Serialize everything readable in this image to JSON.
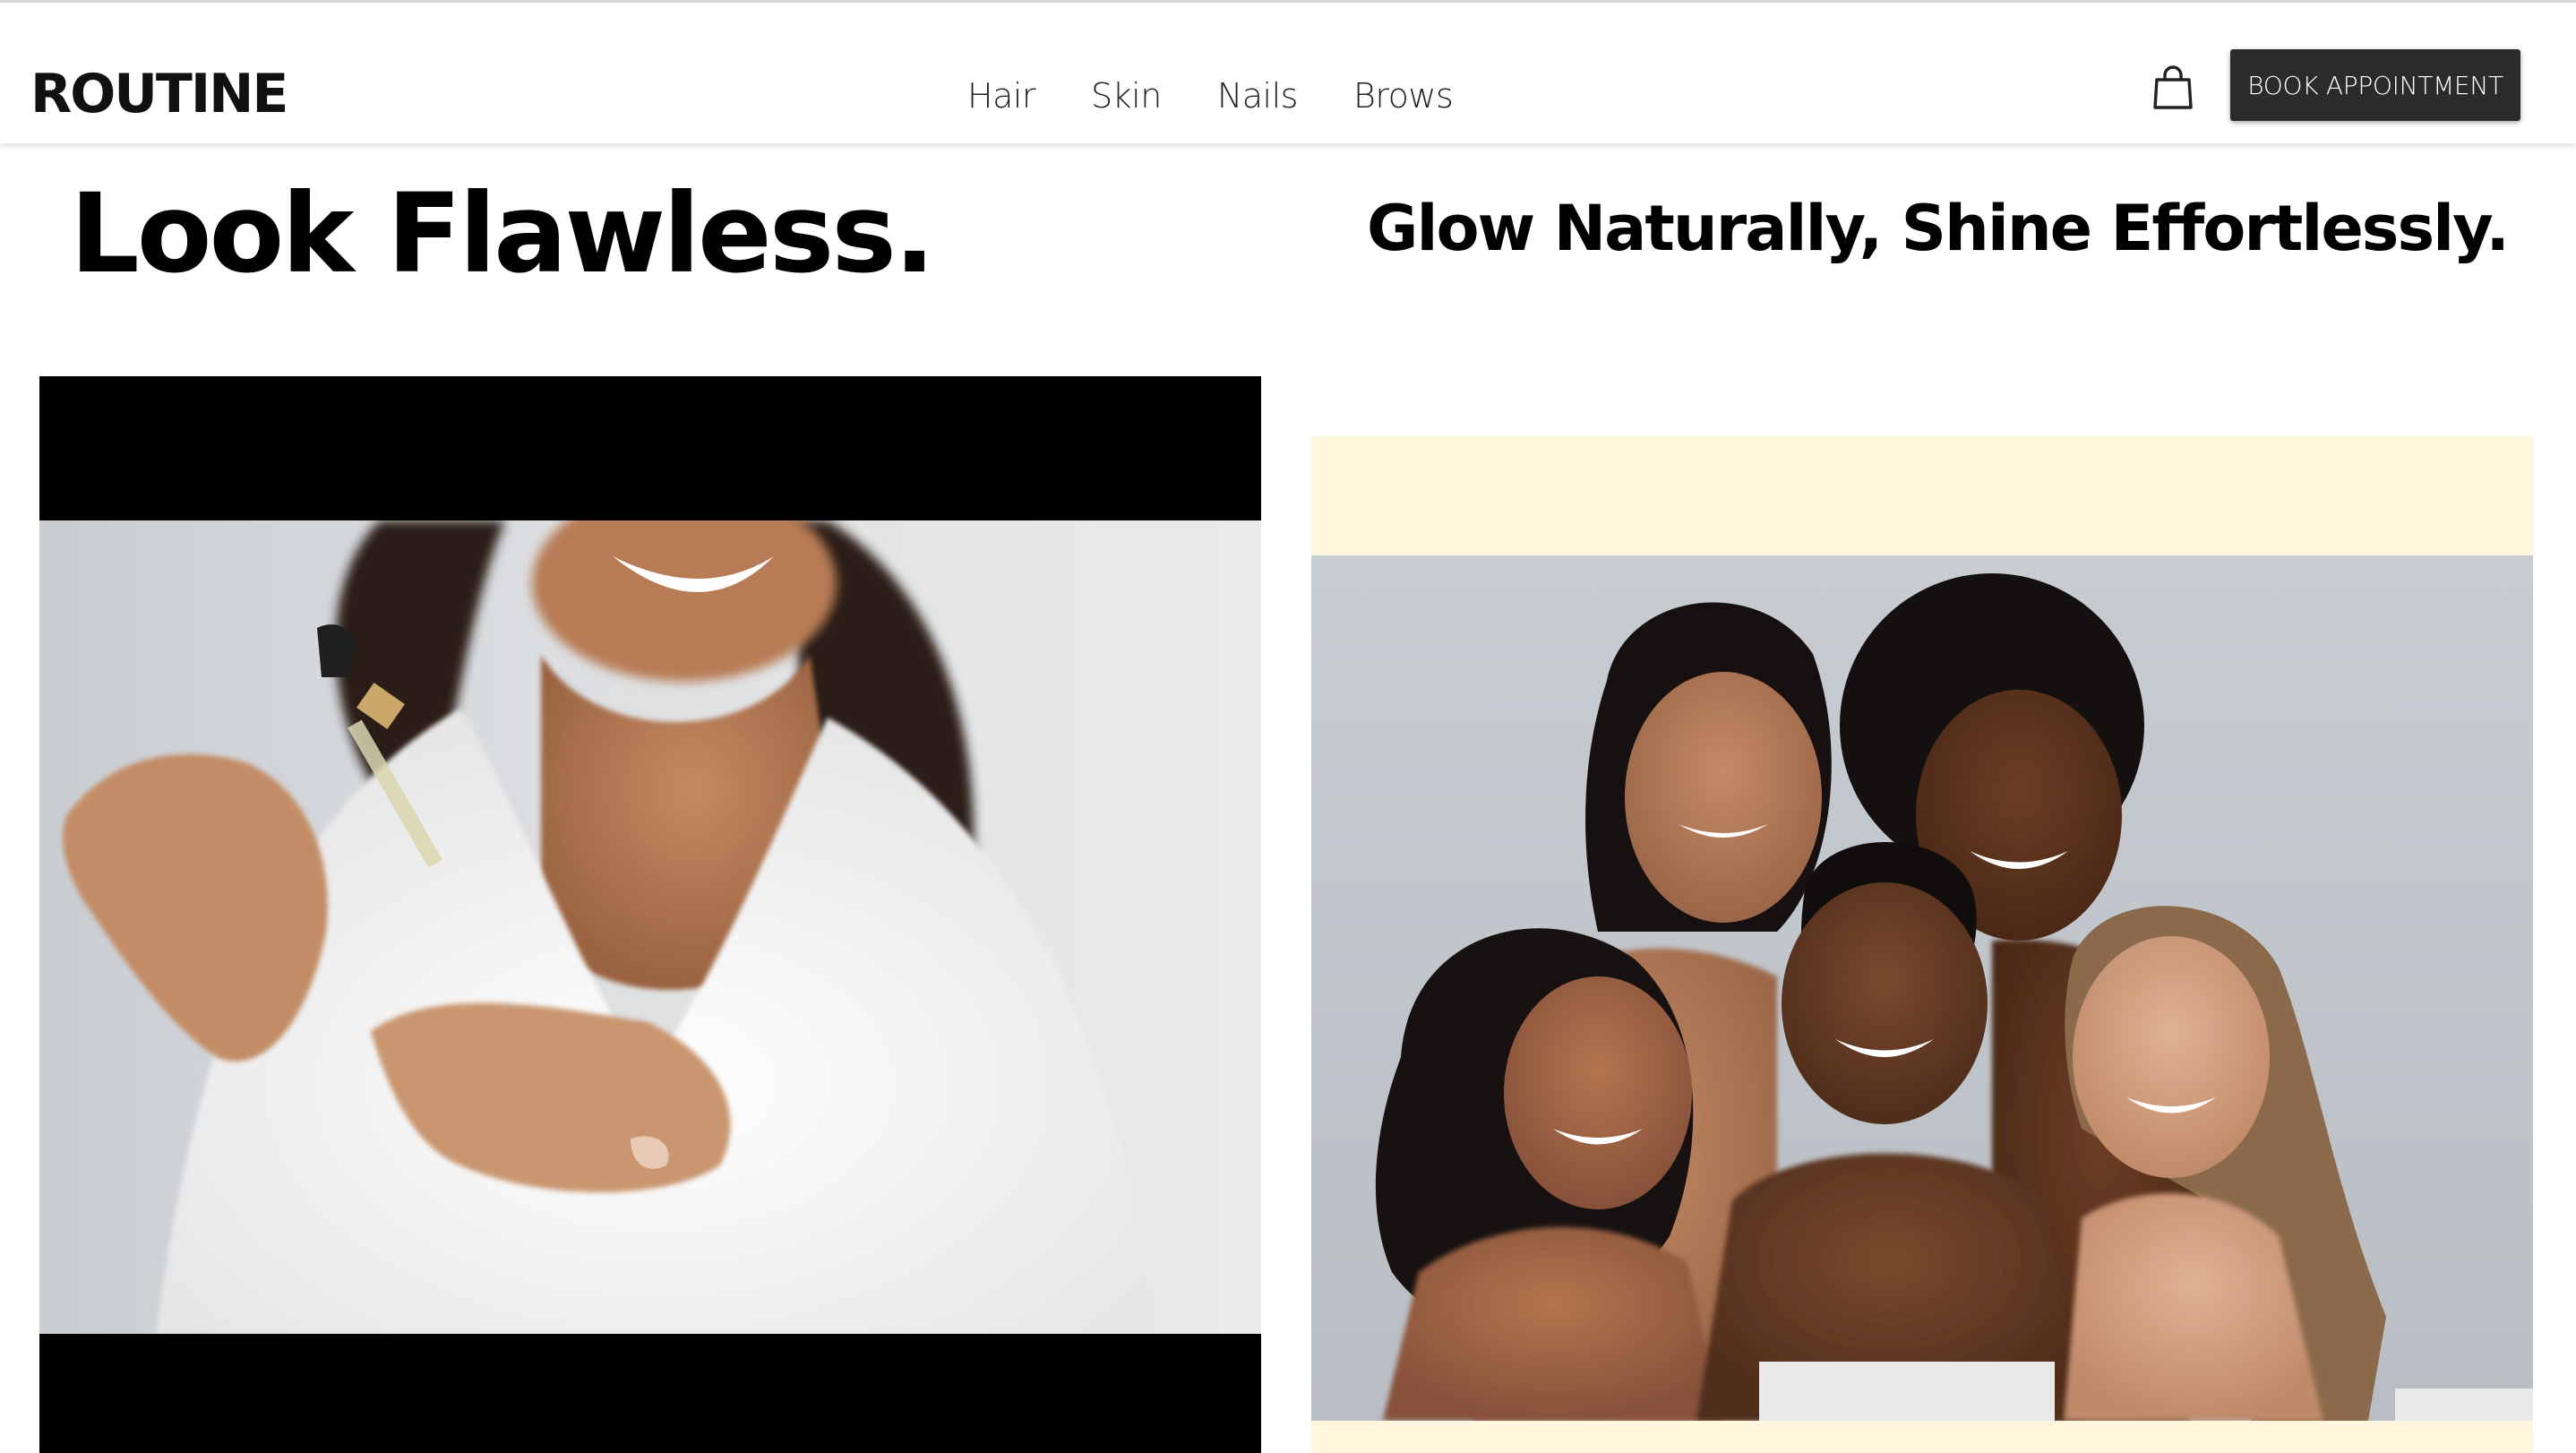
{
  "brand": {
    "logo_text": "ROUTINE"
  },
  "nav": {
    "items": [
      "Hair",
      "Skin",
      "Nails",
      "Brows"
    ]
  },
  "header": {
    "cart_icon": "shopping-bag-icon",
    "book_label": "BOOK APPOINTMENT"
  },
  "hero": {
    "left_title": "Look Flawless.",
    "right_title": "Glow Naturally, Shine Effortlessly."
  },
  "colors": {
    "button_bg": "#2b2b2b",
    "cream_bg": "#fff6dd",
    "text": "#000000"
  }
}
